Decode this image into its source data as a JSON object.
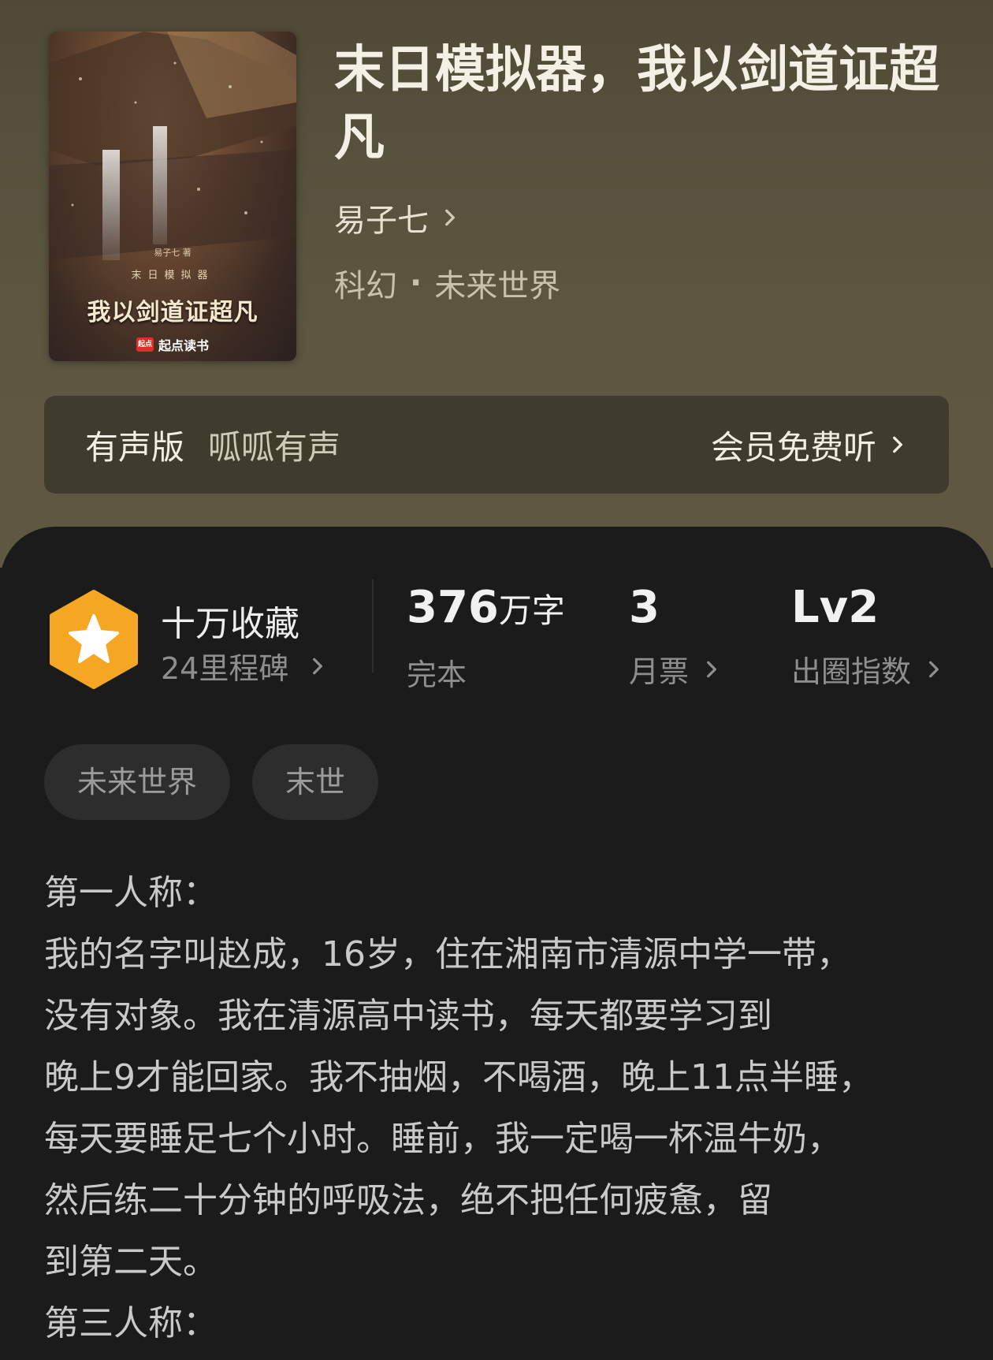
{
  "book": {
    "title": "末日模拟器，我以剑道证超凡",
    "author": "易子七",
    "category": "科幻",
    "subcategory": "未来世界",
    "category_separator": "·"
  },
  "cover": {
    "author_line": "易子七 著",
    "subtitle": "末日模拟器",
    "title": "我以剑道证超凡",
    "brand": "起点读书",
    "brand_mark": "起点"
  },
  "audio": {
    "label": "有声版",
    "provider": "呱呱有声",
    "action": "会员免费听"
  },
  "stats": {
    "collection_title": "十万收藏",
    "collection_sub": "24里程碑",
    "words_value": "376",
    "words_unit": "万字",
    "words_label": "完本",
    "tickets_value": "3",
    "tickets_label": "月票",
    "level_value": "Lv2",
    "level_label": "出圈指数"
  },
  "tags": [
    "未来世界",
    "末世"
  ],
  "description": "第一人称：\n我的名字叫赵成，16岁，住在湘南市清源中学一带，\n没有对象。我在清源高中读书，每天都要学习到\n晚上9才能回家。我不抽烟，不喝酒，晚上11点半睡，\n每天要睡足七个小时。睡前，我一定喝一杯温牛奶，\n然后练二十分钟的呼吸法，绝不把任何疲惫，留\n到第二天。\n第三人称：",
  "colors": {
    "hero_bg": "#5a5440",
    "panel_bg": "#1b1b1b",
    "badge_orange": "#f5a623",
    "tag_bg": "#2d2d2d"
  }
}
